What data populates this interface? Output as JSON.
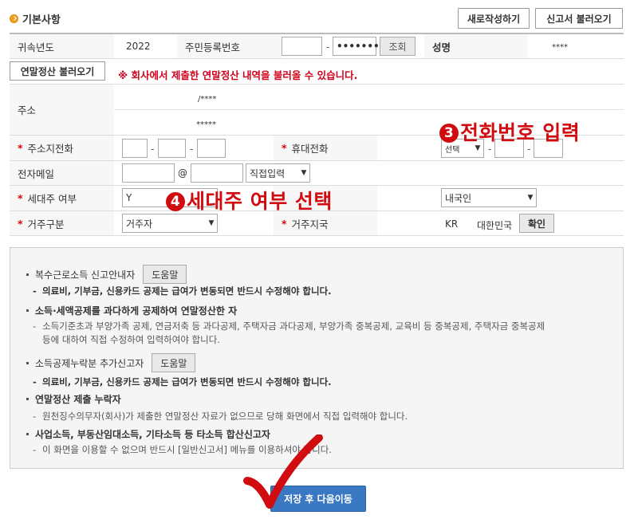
{
  "section": {
    "title": "기본사항"
  },
  "header_buttons": {
    "new": "새로작성하기",
    "load": "신고서 불러오기"
  },
  "row1": {
    "year_label": "귀속년도",
    "year_value": "2022",
    "rrn_label": "주민등록번호",
    "rrn_back": "•••••••",
    "lookup_button": "조회",
    "name_label": "성명",
    "name_value": "****"
  },
  "load_row": {
    "button": "연말정산 불러오기",
    "notice": "※ 회사에서 제출한 연말정산 내역을 불러올 수 있습니다."
  },
  "address": {
    "label": "주소",
    "line1": "/****",
    "line2": "*****"
  },
  "phone_row": {
    "home_label": "주소지전화",
    "mobile_label": "휴대전화",
    "mobile_select": "선택",
    "required_mark": "*"
  },
  "email_row": {
    "label": "전자메일",
    "at": "@",
    "domain_select": "직접입력"
  },
  "household_row": {
    "label": "세대주 여부",
    "value": "Y",
    "nationality_select": "내국인"
  },
  "residence_row": {
    "label": "거주구분",
    "select": "거주자",
    "country_label": "거주지국",
    "country_code": "KR",
    "country_name": "대한민국",
    "confirm_button": "확인"
  },
  "annotations": {
    "phone": {
      "num": "3",
      "text": "전화번호 입력"
    },
    "household": {
      "num": "4",
      "text": "세대주 여부 선택"
    }
  },
  "info": {
    "items": [
      {
        "title": "복수근로소득 신고안내자",
        "help": "도움말",
        "sub": "의료비, 기부금, 신용카드 공제는 급여가 변동되면 반드시 수정해야 합니다."
      },
      {
        "title": "소득·세액공제를 과다하게 공제하여 연말정산한 자",
        "sub1": "소득기준초과 부양가족 공제, 연금저축 등 과다공제, 주택자금 과다공제, 부양가족 중복공제, 교육비 등 중복공제, 주택자금 중복공제",
        "sub2": "등에 대하여 직접 수정하여 입력하여야 합니다."
      },
      {
        "title": "소득공제누락분 추가신고자",
        "help": "도움말",
        "sub": "의료비, 기부금, 신용카드 공제는 급여가 변동되면 반드시 수정해야 합니다."
      },
      {
        "title": "연말정산 제출 누락자",
        "sub": "원천징수의무자(회사)가 제출한 연말정산 자료가 없으므로 당해 화면에서 직접 입력해야 합니다."
      },
      {
        "title": "사업소득, 부동산임대소득, 기타소득 등 타소득 합산신고자",
        "sub": "이 화면을 이용할 수 없으며 반드시 [일반신고서] 메뉴를 이용하셔야 합니다."
      }
    ]
  },
  "save_button": "저장 후 다음이동",
  "colors": {
    "accent": "#3b78c3",
    "annotation": "#d00c10",
    "notice": "#d0021b"
  }
}
